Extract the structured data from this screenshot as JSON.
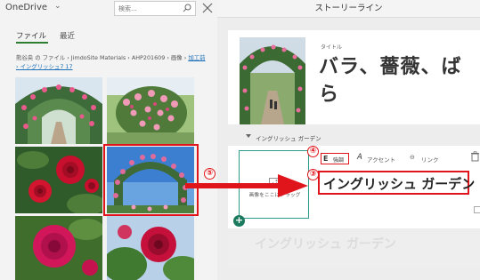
{
  "picker": {
    "app_title": "OneDrive",
    "search_placeholder": "検索...",
    "tabs": [
      {
        "label": "ファイル",
        "active": true
      },
      {
        "label": "最近",
        "active": false
      }
    ],
    "breadcrumb": {
      "prefix": "熊谷央 の ファイル › JimdoSite Materials › AHP201609 › 画像 › ",
      "link": "加工前 › イングリッシュ7 17"
    },
    "thumbnails": [
      {
        "name": "rose-arch-path"
      },
      {
        "name": "rose-garden-pink"
      },
      {
        "name": "red-roses-closeup"
      },
      {
        "name": "rose-arch-sky",
        "selected": true
      },
      {
        "name": "pink-rose-single"
      },
      {
        "name": "red-rose-bud"
      }
    ]
  },
  "storyline": {
    "header_title": "ストーリーライン",
    "title_card": {
      "kind_label": "タイトル",
      "text": "バラ、薔薇、ばら"
    },
    "section": {
      "label": "イングリッシュ ガーデン",
      "drop_text": "画像をここにドラッグ",
      "format": {
        "emphasis_icon": "E",
        "emphasis_label": "強調",
        "accent_icon": "A",
        "accent_label": "アクセント",
        "link_icon": "⊖",
        "link_label": "リンク"
      },
      "heading_text": "イングリッシュ ガーデン",
      "watermark_text": "イングリッシュ ガーデン"
    }
  },
  "annotations": {
    "step_4": "④",
    "step_3": "③",
    "step_5": "⑤"
  },
  "colors": {
    "accent_red": "#e0151b",
    "sway_green": "#1b7a5d",
    "onedrive_green": "#2e7d32"
  }
}
